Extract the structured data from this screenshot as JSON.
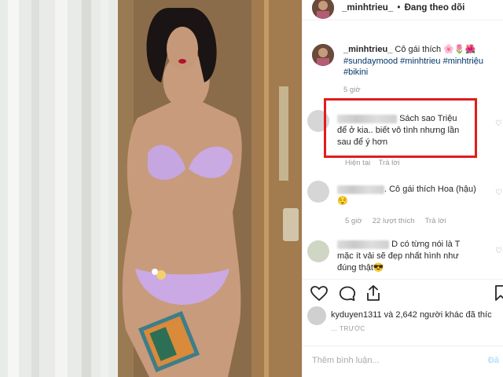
{
  "header": {
    "username": "_minhtrieu_",
    "separator": "•",
    "follow_status": "Đang theo dõi"
  },
  "caption": {
    "username": "_minhtrieu_",
    "text": "Cô gái thích 🌸🌷🌺",
    "hashtags_line1": "#sundaymood #minhtrieu #minhtriệu",
    "hashtags_line2": "#bikini",
    "time": "5 giờ"
  },
  "comments": [
    {
      "line1": "Sách sao Triệu",
      "line2": "để ở kia.. biết vô tình nhưng lần",
      "line3": "sau để ý hơn",
      "time": "Hiện tại",
      "reply": "Trả lời"
    },
    {
      "line1": ". Cô gái thích Hoa (hậu)",
      "line2": "😌",
      "time": "5 giờ",
      "likes": "22 lượt thích",
      "reply": "Trả lời"
    },
    {
      "line1": "D có từng nói là T",
      "line2": "mặc ít vải sẽ đẹp nhất hình như",
      "line3": "đúng thật😎"
    }
  ],
  "likes": {
    "text": "kyduyen1311 và 2,642 người khác đã thíc"
  },
  "time_ago": "… TRƯỚC",
  "add_comment": {
    "placeholder": "Thêm bình luận...",
    "post_label": "Đă"
  },
  "colors": {
    "highlight_box": "#e21c1c",
    "hashtag": "#003569"
  }
}
